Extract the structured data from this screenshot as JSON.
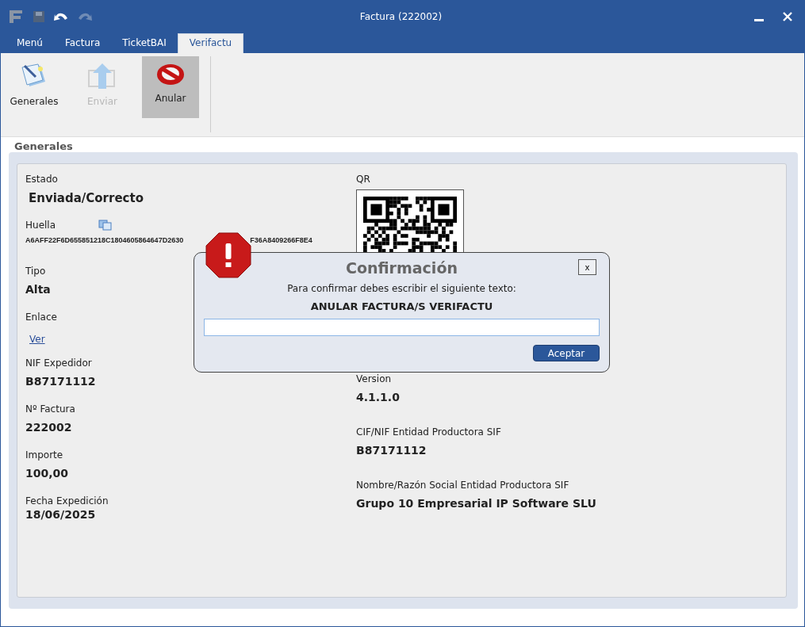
{
  "window": {
    "title": "Factura (222002)"
  },
  "tabs": [
    {
      "label": "Menú",
      "selected": false
    },
    {
      "label": "Factura",
      "selected": false
    },
    {
      "label": "TicketBAI",
      "selected": false
    },
    {
      "label": "Verifactu",
      "selected": true
    }
  ],
  "ribbon": [
    {
      "label": "Generales",
      "disabled": false,
      "selected": false
    },
    {
      "label": "Enviar",
      "disabled": true,
      "selected": false
    },
    {
      "label": "Anular",
      "disabled": false,
      "selected": true
    }
  ],
  "group": {
    "title": "Generales",
    "left_fields": [
      {
        "label": "Estado",
        "kind": "status",
        "value": "Enviada/Correcto"
      },
      {
        "label": "Huella",
        "kind": "hash",
        "value_parts": [
          "A6AFF22F6D655851218C1804605864647D2630",
          "F36A8409266F8E4"
        ]
      },
      {
        "label": "Tipo",
        "kind": "text",
        "value": "Alta"
      },
      {
        "label": "Enlace",
        "kind": "link",
        "value": "Ver"
      },
      {
        "label": "NIF Expedidor",
        "kind": "text",
        "value": "B87171112"
      },
      {
        "label": "Nº Factura",
        "kind": "text",
        "value": "222002"
      },
      {
        "label": "Importe",
        "kind": "text",
        "value": "100,00"
      },
      {
        "label": "Fecha Expedición",
        "kind": "date",
        "value": "18/06/2025"
      }
    ],
    "qr_label": "QR",
    "right_fields": [
      {
        "label": "Version",
        "value": "4.1.1.0"
      },
      {
        "label": "CIF/NIF Entidad Productora SIF",
        "value": "B87171112"
      },
      {
        "label": "Nombre/Razón Social Entidad Productora SIF",
        "value": "Grupo 10 Empresarial IP Software SLU"
      }
    ]
  },
  "dialog": {
    "title": "Confirmación",
    "close": "x",
    "message": "Para confirmar debes escribir el siguiente texto:",
    "phrase": "ANULAR FACTURA/S VERIFACTU",
    "button": "Aceptar"
  }
}
